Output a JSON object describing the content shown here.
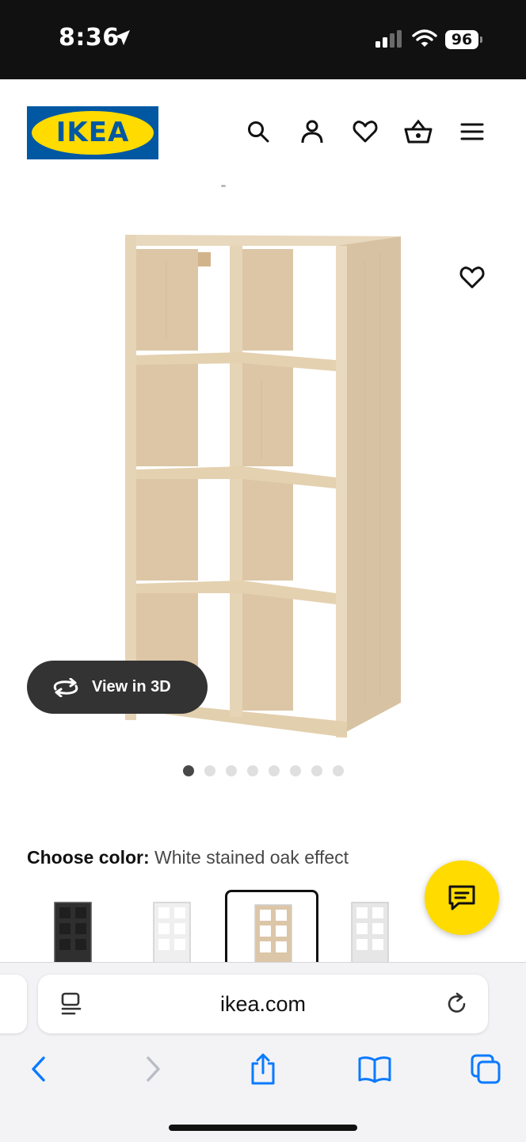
{
  "status_bar": {
    "time": "8:36",
    "battery": "96",
    "icons": [
      "location-arrow-icon",
      "cellular-signal-icon",
      "wifi-icon",
      "battery-icon"
    ]
  },
  "header": {
    "logo_text": "IKEA",
    "brand_colors": {
      "blue": "#0058a3",
      "yellow": "#ffdb00"
    },
    "icons": [
      "search-icon",
      "account-icon",
      "heart-icon",
      "shopping-basket-icon",
      "hamburger-menu-icon"
    ]
  },
  "gallery": {
    "view_3d_label": "View in 3D",
    "image_count": 8,
    "active_index": 0,
    "wishlist_icon": "heart-icon"
  },
  "color_picker": {
    "label": "Choose color:",
    "selected": "White stained oak effect",
    "swatch_colors": [
      "#2f2f2f",
      "#efefef",
      "#dcc6a8",
      "#e6e6e6"
    ],
    "selected_swatch": 2
  },
  "chat": {
    "icon": "chat-bubble-icon",
    "color": "#ffdb00"
  },
  "browser": {
    "url": "ikea.com",
    "icons": [
      "page-menu-icon",
      "reload-icon",
      "back-icon",
      "forward-icon",
      "share-icon",
      "bookmarks-icon",
      "tabs-icon"
    ],
    "accent": "#0a7aff"
  }
}
